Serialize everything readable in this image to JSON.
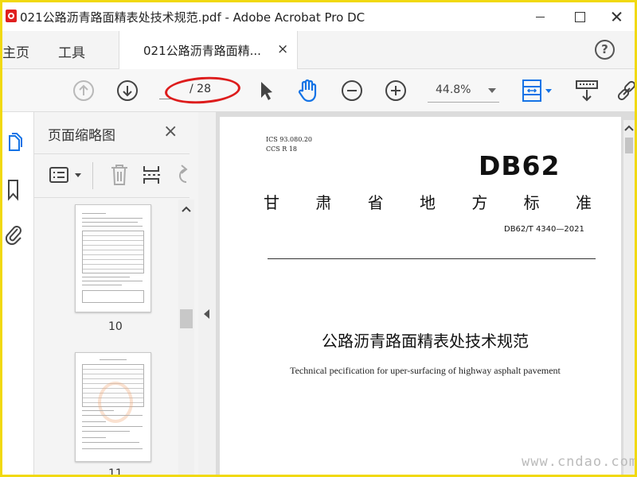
{
  "window": {
    "title": "021公路沥青路面精表处技术规范.pdf - Adobe Acrobat Pro DC"
  },
  "tabs": {
    "home": "主页",
    "tools": "工具",
    "document": "021公路沥青路面精...",
    "close_glyph": "×",
    "help_glyph": "?"
  },
  "toolbar": {
    "page_current": "",
    "page_total": "/ 28",
    "zoom": "44.8%"
  },
  "panel": {
    "title": "页面缩略图",
    "close_glyph": "×",
    "thumbnails": [
      {
        "label": "10"
      },
      {
        "label": "11"
      }
    ]
  },
  "document": {
    "ics_line": "ICS  93.080.20",
    "ccs_line": "CCS  R  18",
    "db_code": "DB62",
    "standard_type": [
      "甘",
      "肃",
      "省",
      "地",
      "方",
      "标",
      "准"
    ],
    "standard_number": "DB62/T  4340—2021",
    "title_cn": "公路沥青路面精表处技术规范",
    "title_en": "Technical pecification for uper-surfacing of highway asphalt pavement"
  },
  "watermark": "www.cndao.com",
  "colors": {
    "frame": "#f1d90f",
    "highlight_ring": "#dd1c1c",
    "accent_blue": "#1473e6"
  },
  "icons": {
    "title_bar": [
      "acrobat-logo-icon",
      "minimize-icon",
      "maximize-icon",
      "close-icon"
    ],
    "toolbar": [
      "page-up-icon",
      "page-down-icon",
      "select-arrow-icon",
      "hand-tool-icon",
      "zoom-out-icon",
      "zoom-in-icon",
      "page-fit-icon",
      "scroll-mode-icon",
      "link-icon"
    ],
    "rail": [
      "page-thumbnails-icon",
      "bookmark-icon",
      "attachment-icon"
    ],
    "panel": [
      "page-options-icon",
      "delete-icon",
      "insert-page-icon",
      "undo-icon"
    ]
  }
}
